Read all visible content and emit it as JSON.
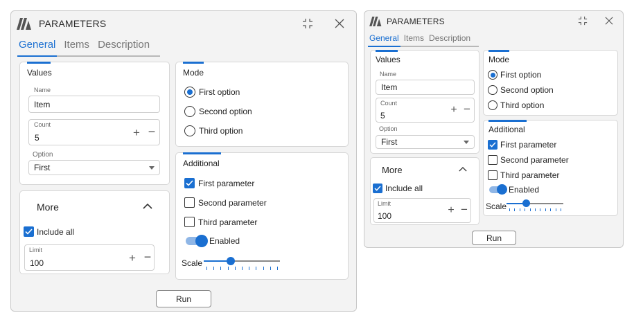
{
  "windows": [
    {
      "title": "PARAMETERS",
      "tabs": [
        {
          "label": "General"
        },
        {
          "label": "Items"
        },
        {
          "label": "Description"
        }
      ],
      "values": {
        "title": "Values",
        "name_label": "Name",
        "name_value": "Item",
        "count_label": "Count",
        "count_value": "5",
        "option_label": "Option",
        "option_value": "First"
      },
      "mode": {
        "title": "Mode",
        "options": [
          {
            "label": "First option"
          },
          {
            "label": "Second option"
          },
          {
            "label": "Third option"
          }
        ],
        "selected_index": 0
      },
      "more": {
        "title": "More",
        "include_all_label": "Include all",
        "include_all_checked": true,
        "limit_label": "Limit",
        "limit_value": "100"
      },
      "additional": {
        "title": "Additional",
        "params": [
          {
            "label": "First parameter",
            "checked": true
          },
          {
            "label": "Second parameter",
            "checked": false
          },
          {
            "label": "Third parameter",
            "checked": false
          }
        ],
        "toggle_label": "Enabled",
        "toggle_on": true,
        "scale_label": "Scale",
        "scale_fraction": 0.35
      },
      "run_label": "Run",
      "icons": {
        "minimize": "compress-icon",
        "close": "close-icon",
        "logo": "logo-icon"
      }
    },
    {
      "title": "PARAMETERS",
      "tabs": [
        {
          "label": "General"
        },
        {
          "label": "Items"
        },
        {
          "label": "Description"
        }
      ],
      "values": {
        "title": "Values",
        "name_label": "Name",
        "name_value": "Item",
        "count_label": "Count",
        "count_value": "5",
        "option_label": "Option",
        "option_value": "First"
      },
      "mode": {
        "title": "Mode",
        "options": [
          {
            "label": "First option"
          },
          {
            "label": "Second option"
          },
          {
            "label": "Third option"
          }
        ],
        "selected_index": 0
      },
      "more": {
        "title": "More",
        "include_all_label": "Include all",
        "include_all_checked": true,
        "limit_label": "Limit",
        "limit_value": "100"
      },
      "additional": {
        "title": "Additional",
        "params": [
          {
            "label": "First parameter",
            "checked": true
          },
          {
            "label": "Second parameter",
            "checked": false
          },
          {
            "label": "Third parameter",
            "checked": false
          }
        ],
        "toggle_label": "Enabled",
        "toggle_on": true,
        "scale_label": "Scale",
        "scale_fraction": 0.35
      },
      "run_label": "Run",
      "icons": {
        "minimize": "compress-icon",
        "close": "close-icon",
        "logo": "logo-icon"
      }
    }
  ],
  "colors": {
    "accent": "#1a6fd1",
    "window_bg": "#f3f3f3",
    "panel_bg": "#ffffff"
  }
}
